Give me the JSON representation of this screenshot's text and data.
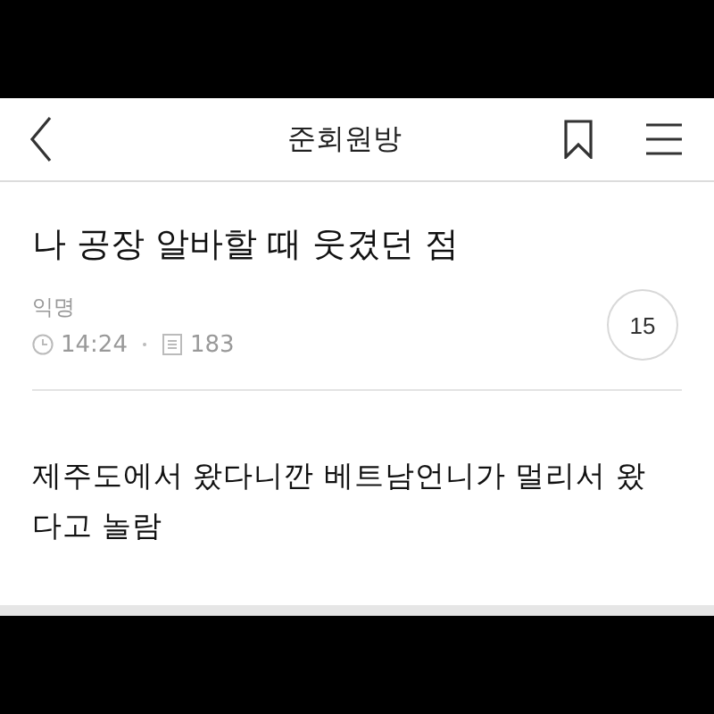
{
  "header": {
    "title": "준회원방"
  },
  "post": {
    "title": "나 공장 알바할 때 웃겼던 점",
    "author": "익명",
    "time": "14:24",
    "views": "183",
    "comment_count": "15",
    "body": "제주도에서 왔다니깐 베트남언니가 멀리서 왔다고 놀람"
  }
}
